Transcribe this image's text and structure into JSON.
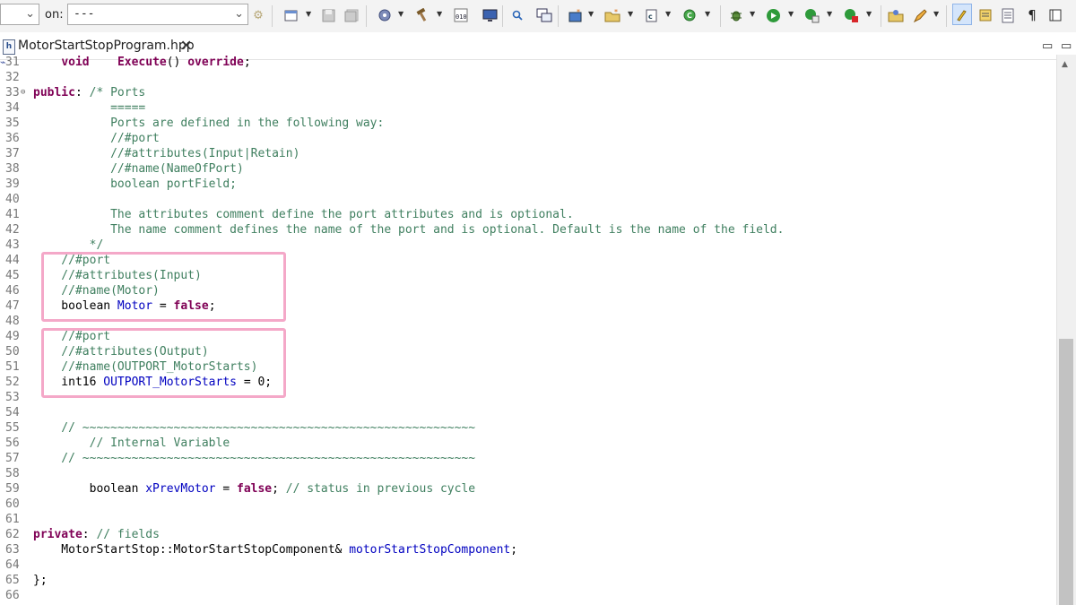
{
  "toolbar": {
    "left_dropdown_value": "",
    "on_label": "on:",
    "on_dropdown_value": "---",
    "icons": [
      "settings-gear-icon",
      "new-window-icon",
      "save-icon",
      "save-all-icon",
      "build-target-icon",
      "hammer-build-icon",
      "binary-010-icon",
      "monitor-icon",
      "search-tool-icon",
      "copy-window-icon",
      "new-class-icon",
      "new-folder-icon",
      "new-c-file-icon",
      "refresh-run-icon",
      "debug-bug-icon",
      "run-play-icon",
      "run-config-icon",
      "external-tool-icon",
      "open-folder-icon",
      "pen-edit-icon",
      "highlight-brush-icon",
      "mark-occurrences-icon",
      "show-whitespace-icon",
      "pilcrow-icon"
    ]
  },
  "tab": {
    "file_icon_text": "h",
    "label": "MotorStartStopProgram.hpp",
    "close": "✕"
  },
  "editor": {
    "lines": [
      {
        "n": "31",
        "segs": [
          [
            "",
            "    "
          ],
          [
            "kw",
            "void"
          ],
          [
            "",
            "    "
          ],
          [
            "kw",
            "Execute"
          ],
          [
            "",
            "() "
          ],
          [
            "kw",
            "override"
          ],
          [
            "",
            ";"
          ]
        ]
      },
      {
        "n": "32",
        "segs": []
      },
      {
        "n": "33",
        "fold": true,
        "segs": [
          [
            "kw",
            "public"
          ],
          [
            "",
            ": "
          ],
          [
            "cm",
            "/* Ports"
          ]
        ]
      },
      {
        "n": "34",
        "segs": [
          [
            "cm",
            "           ====="
          ]
        ]
      },
      {
        "n": "35",
        "segs": [
          [
            "cm",
            "           Ports are defined in the following way:"
          ]
        ]
      },
      {
        "n": "36",
        "segs": [
          [
            "cm",
            "           //#port"
          ]
        ]
      },
      {
        "n": "37",
        "segs": [
          [
            "cm",
            "           //#attributes(Input|Retain)"
          ]
        ]
      },
      {
        "n": "38",
        "segs": [
          [
            "cm",
            "           //#name(NameOfPort)"
          ]
        ]
      },
      {
        "n": "39",
        "segs": [
          [
            "cm",
            "           boolean portField;"
          ]
        ]
      },
      {
        "n": "40",
        "segs": []
      },
      {
        "n": "41",
        "segs": [
          [
            "cm",
            "           The attributes comment define the port attributes and is optional."
          ]
        ]
      },
      {
        "n": "42",
        "segs": [
          [
            "cm",
            "           The name comment defines the name of the port and is optional. Default is the name of the field."
          ]
        ]
      },
      {
        "n": "43",
        "segs": [
          [
            "cm",
            "        */"
          ]
        ]
      },
      {
        "n": "44",
        "segs": [
          [
            "cm",
            "    //#port"
          ]
        ]
      },
      {
        "n": "45",
        "segs": [
          [
            "cm",
            "    //#attributes(Input)"
          ]
        ]
      },
      {
        "n": "46",
        "segs": [
          [
            "cm",
            "    //#name(Motor)"
          ]
        ]
      },
      {
        "n": "47",
        "segs": [
          [
            "",
            "    boolean "
          ],
          [
            "fld",
            "Motor"
          ],
          [
            "",
            " = "
          ],
          [
            "kw",
            "false"
          ],
          [
            "",
            ";"
          ]
        ]
      },
      {
        "n": "48",
        "segs": []
      },
      {
        "n": "49",
        "segs": [
          [
            "cm",
            "    //#port"
          ]
        ]
      },
      {
        "n": "50",
        "segs": [
          [
            "cm",
            "    //#attributes(Output)"
          ]
        ]
      },
      {
        "n": "51",
        "segs": [
          [
            "cm",
            "    //#name(OUTPORT_MotorStarts)"
          ]
        ]
      },
      {
        "n": "52",
        "segs": [
          [
            "",
            "    int16 "
          ],
          [
            "fld",
            "OUTPORT_MotorStarts"
          ],
          [
            "",
            " = 0;"
          ]
        ]
      },
      {
        "n": "53",
        "segs": []
      },
      {
        "n": "54",
        "segs": []
      },
      {
        "n": "55",
        "segs": [
          [
            "cm",
            "    // ~~~~~~~~~~~~~~~~~~~~~~~~~~~~~~~~~~~~~~~~~~~~~~~~~~~~~~~~"
          ]
        ]
      },
      {
        "n": "56",
        "segs": [
          [
            "cm",
            "        // Internal Variable"
          ]
        ]
      },
      {
        "n": "57",
        "segs": [
          [
            "cm",
            "    // ~~~~~~~~~~~~~~~~~~~~~~~~~~~~~~~~~~~~~~~~~~~~~~~~~~~~~~~~"
          ]
        ]
      },
      {
        "n": "58",
        "segs": []
      },
      {
        "n": "59",
        "segs": [
          [
            "",
            "        boolean "
          ],
          [
            "fld",
            "xPrevMotor"
          ],
          [
            "",
            " = "
          ],
          [
            "kw",
            "false"
          ],
          [
            "",
            "; "
          ],
          [
            "cm",
            "// status in previous cycle"
          ]
        ]
      },
      {
        "n": "60",
        "segs": []
      },
      {
        "n": "61",
        "segs": []
      },
      {
        "n": "62",
        "segs": [
          [
            "kw",
            "private"
          ],
          [
            "",
            ": "
          ],
          [
            "cm",
            "// fields"
          ]
        ]
      },
      {
        "n": "63",
        "segs": [
          [
            "",
            "    MotorStartStop::MotorStartStopComponent& "
          ],
          [
            "fld",
            "motorStartStopComponent"
          ],
          [
            "",
            ";"
          ]
        ]
      },
      {
        "n": "64",
        "segs": []
      },
      {
        "n": "65",
        "segs": [
          [
            "",
            "};"
          ]
        ]
      },
      {
        "n": "66",
        "segs": []
      }
    ]
  },
  "colors": {
    "keyword": "#7f0055",
    "comment": "#3f7f5f",
    "field": "#0000c0",
    "highlight_box": "#f4a8c8"
  }
}
